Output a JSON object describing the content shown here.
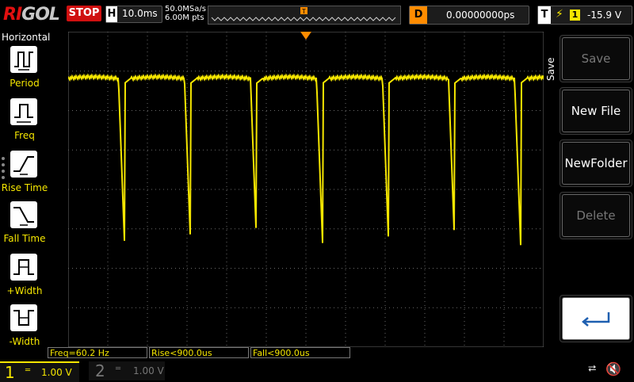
{
  "header": {
    "brand_prefix": "RI",
    "brand_rest": "GOL",
    "run_state": "STOP",
    "timebase_key": "H",
    "timebase": "10.0ms",
    "sample_rate": "50.0MSa/s",
    "memory_depth": "6.00M pts",
    "trigger_marker": "T",
    "delay_key": "D",
    "delay": "0.00000000ps",
    "trigger_key": "T",
    "trigger_source": "1",
    "trigger_level": "-15.9 V",
    "trigger_edge_icon": "rising-edge-icon"
  },
  "left_menu": {
    "title": "Horizontal",
    "items": [
      {
        "label": "Period",
        "icon": "period-icon"
      },
      {
        "label": "Freq",
        "icon": "frequency-icon"
      },
      {
        "label": "Rise Time",
        "icon": "rise-time-icon"
      },
      {
        "label": "Fall Time",
        "icon": "fall-time-icon"
      },
      {
        "label": "+Width",
        "icon": "positive-width-icon"
      },
      {
        "label": "-Width",
        "icon": "negative-width-icon"
      }
    ]
  },
  "right_menu": {
    "title": "Save",
    "buttons": [
      {
        "label": "Save",
        "enabled": false
      },
      {
        "label": "New File",
        "enabled": true
      },
      {
        "label": "NewFolder",
        "enabled": true
      },
      {
        "label": "Delete",
        "enabled": false
      },
      {
        "label": "",
        "icon": "return-arrow-icon",
        "enabled": true
      }
    ]
  },
  "measurements": [
    {
      "text": "Freq=60.2 Hz"
    },
    {
      "text": "Rise<900.0us"
    },
    {
      "text": "Fall<900.0us"
    }
  ],
  "channels": {
    "ch1": {
      "number": "1",
      "scale": "1.00 V",
      "color": "#f5e600"
    },
    "ch2": {
      "number": "2",
      "scale": "1.00 V",
      "color": "#777777"
    }
  },
  "status_icons": {
    "usb": "usb-icon",
    "sound": "speaker-muted-icon"
  },
  "colors": {
    "trace": "#f5e600",
    "grid": "#6a6a6a",
    "stop": "#d01010",
    "delay_accent": "#ff8c00"
  }
}
